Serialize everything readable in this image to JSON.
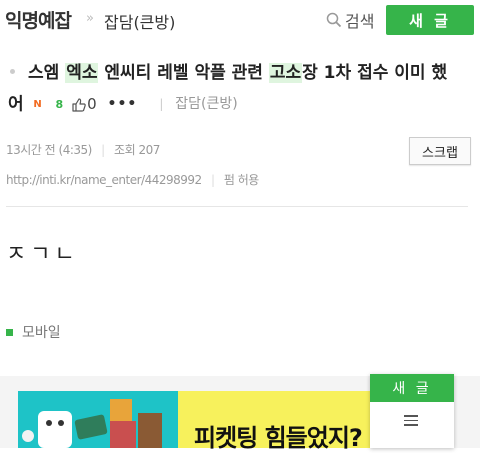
{
  "header": {
    "board_title": "익명예잡",
    "crumb_separator": "»",
    "category": "잡담(큰방)",
    "search_label": "검색",
    "new_post_label": "새 글"
  },
  "post": {
    "title_parts": [
      {
        "text": "스엠 ",
        "highlight": false
      },
      {
        "text": "엑소",
        "highlight": true
      },
      {
        "text": " 엔씨티 레벨 악플 관련 ",
        "highlight": false
      },
      {
        "text": "고소",
        "highlight": true
      },
      {
        "text": "장 1차 접수 이미 했",
        "highlight": false
      }
    ],
    "title_line2": "어",
    "new_badge": "N",
    "comment_count": "8",
    "like_count": "0",
    "more": "•••",
    "meta_separator": "|",
    "meta_category": "잡담(큰방)",
    "time": "13시간 전 (4:35)",
    "separator": "|",
    "views": "조회 207",
    "scrap_label": "스크랩",
    "url": "http://inti.kr/name_enter/44298992",
    "permission": "펌 허용",
    "body": "ㅈㄱㄴ",
    "source": "모바일"
  },
  "ad": {
    "text": "피켓팅 힘들었지?"
  },
  "floating": {
    "new_post_label": "새 글",
    "menu_icon": "hamburger-icon"
  },
  "colors": {
    "accent": "#36b44a",
    "highlight": "#dff5df",
    "new_badge": "#f26b21"
  }
}
